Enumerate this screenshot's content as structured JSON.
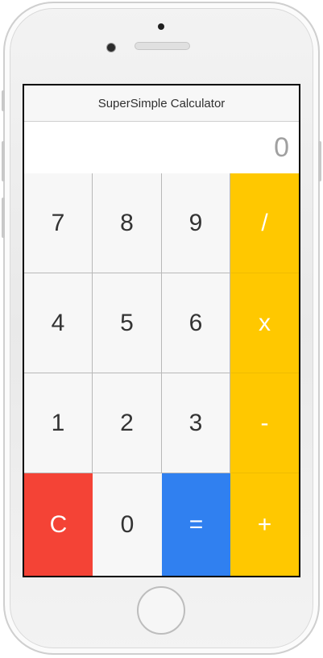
{
  "app": {
    "title": "SuperSimple Calculator"
  },
  "display": {
    "value": "0"
  },
  "keypad": {
    "row1": [
      "7",
      "8",
      "9",
      "/"
    ],
    "row2": [
      "4",
      "5",
      "6",
      "x"
    ],
    "row3": [
      "1",
      "2",
      "3",
      "-"
    ],
    "row4": [
      "C",
      "0",
      "=",
      "+"
    ]
  },
  "colors": {
    "operator": "#ffc800",
    "clear": "#f44336",
    "equals": "#3080f0",
    "digit_bg": "#f7f7f7"
  }
}
